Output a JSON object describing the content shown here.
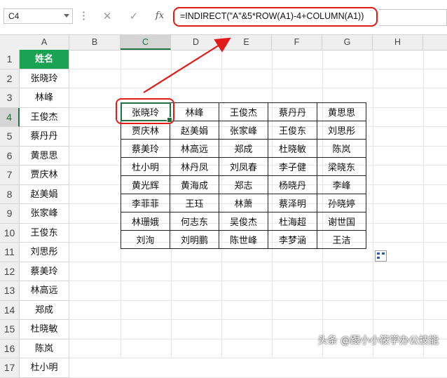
{
  "formula_bar": {
    "name_box": "C4",
    "cancel_glyph": "✕",
    "enter_glyph": "✓",
    "fx_label": "fx",
    "formula": "=INDIRECT(\"A\"&5*ROW(A1)-4+COLUMN(A1))"
  },
  "columns": [
    "A",
    "B",
    "C",
    "D",
    "E",
    "F",
    "G",
    "H"
  ],
  "rows": [
    "1",
    "2",
    "3",
    "4",
    "5",
    "6",
    "7",
    "8",
    "9",
    "10",
    "11",
    "12",
    "13",
    "14",
    "15",
    "16",
    "17"
  ],
  "selected": {
    "column": "C",
    "row": "4"
  },
  "column_a": {
    "header": "姓名",
    "names": [
      "张晓玲",
      "林峰",
      "王俊杰",
      "蔡丹丹",
      "黄思思",
      "贾庆林",
      "赵美娟",
      "张家峰",
      "王俊东",
      "刘思彤",
      "蔡美玲",
      "林高远",
      "郑成",
      "杜晓敏",
      "陈岚",
      "杜小明"
    ]
  },
  "table": [
    [
      "张晓玲",
      "林峰",
      "王俊杰",
      "蔡丹丹",
      "黄思思"
    ],
    [
      "贾庆林",
      "赵美娟",
      "张家峰",
      "王俊东",
      "刘思彤"
    ],
    [
      "蔡美玲",
      "林高远",
      "郑成",
      "杜晓敏",
      "陈岚"
    ],
    [
      "杜小明",
      "林丹凤",
      "刘凤春",
      "李子健",
      "梁晓东"
    ],
    [
      "黄光辉",
      "黄海成",
      "郑志",
      "杨晓丹",
      "李峰"
    ],
    [
      "李菲菲",
      "王珏",
      "林萧",
      "蔡泽明",
      "孙晓婷"
    ],
    [
      "林珊娥",
      "何志东",
      "吴俊杰",
      "杜海超",
      "谢世国"
    ],
    [
      "刘洵",
      "刘明鹏",
      "陈世峰",
      "李梦涵",
      "王洁"
    ]
  ],
  "watermark": "头条 @跟小小筱学办公技能",
  "colors": {
    "accent_red": "#e11a1a",
    "excel_green": "#217346",
    "header_green": "#1aa352"
  },
  "icons": {
    "quick_analysis": "quick-analysis-icon"
  }
}
